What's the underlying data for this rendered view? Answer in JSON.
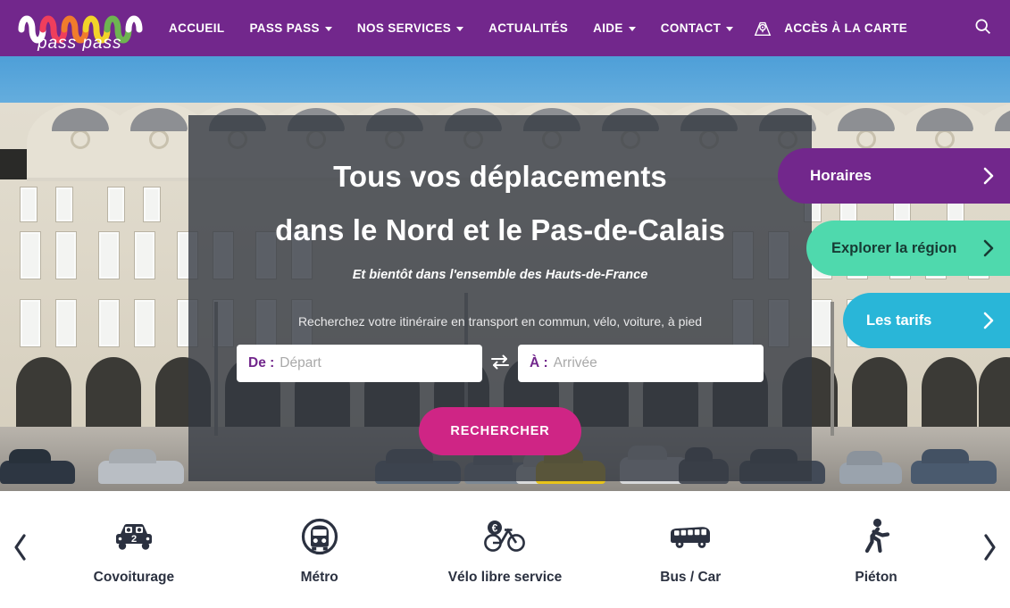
{
  "header": {
    "logo": {
      "name": "pass-pass-logo",
      "text": "pass pass"
    },
    "nav": [
      {
        "label": "ACCUEIL",
        "has_dropdown": false,
        "name": "nav-accueil"
      },
      {
        "label": "PASS PASS",
        "has_dropdown": true,
        "name": "nav-pass-pass"
      },
      {
        "label": "NOS SERVICES",
        "has_dropdown": true,
        "name": "nav-nos-services"
      },
      {
        "label": "ACTUALITÉS",
        "has_dropdown": false,
        "name": "nav-actualites"
      },
      {
        "label": "AIDE",
        "has_dropdown": true,
        "name": "nav-aide"
      },
      {
        "label": "CONTACT",
        "has_dropdown": true,
        "name": "nav-contact"
      },
      {
        "label": "ACCÈS À LA CARTE",
        "has_dropdown": false,
        "name": "nav-acces-carte"
      }
    ],
    "search_icon": "search-icon",
    "colors": {
      "background": "#72278c",
      "text": "#ffffff"
    }
  },
  "hero": {
    "title_line1": "Tous vos déplacements",
    "title_line2": "dans le Nord et le Pas-de-Calais",
    "subtitle": "Et bientôt dans l'ensemble des Hauts-de-France",
    "search_prompt": "Recherchez votre itinéraire en transport en commun, vélo, voiture, à pied",
    "from": {
      "label": "De :",
      "placeholder": "Départ",
      "value": ""
    },
    "to": {
      "label": "À :",
      "placeholder": "Arrivée",
      "value": ""
    },
    "swap_icon": "swap-arrows-icon",
    "submit_label": "RECHERCHER",
    "submit_color": "#cf2585",
    "panel_color": "rgba(52,58,66,0.80)"
  },
  "pills": [
    {
      "label": "Horaires",
      "color": "#72278c",
      "name": "pill-horaires"
    },
    {
      "label": "Explorer la région",
      "color": "#4fd9ad",
      "name": "pill-explorer-region"
    },
    {
      "label": "Les tarifs",
      "color": "#29b6d8",
      "name": "pill-les-tarifs"
    }
  ],
  "modes": {
    "prev_icon": "chevron-left-icon",
    "next_icon": "chevron-right-icon",
    "items": [
      {
        "label": "Covoiturage",
        "icon": "carpool-car-icon"
      },
      {
        "label": "Métro",
        "icon": "metro-train-icon"
      },
      {
        "label": "Vélo libre service",
        "icon": "bike-share-euro-icon"
      },
      {
        "label": "Bus / Car",
        "icon": "bus-icon"
      },
      {
        "label": "Piéton",
        "icon": "pedestrian-walk-icon"
      }
    ]
  }
}
